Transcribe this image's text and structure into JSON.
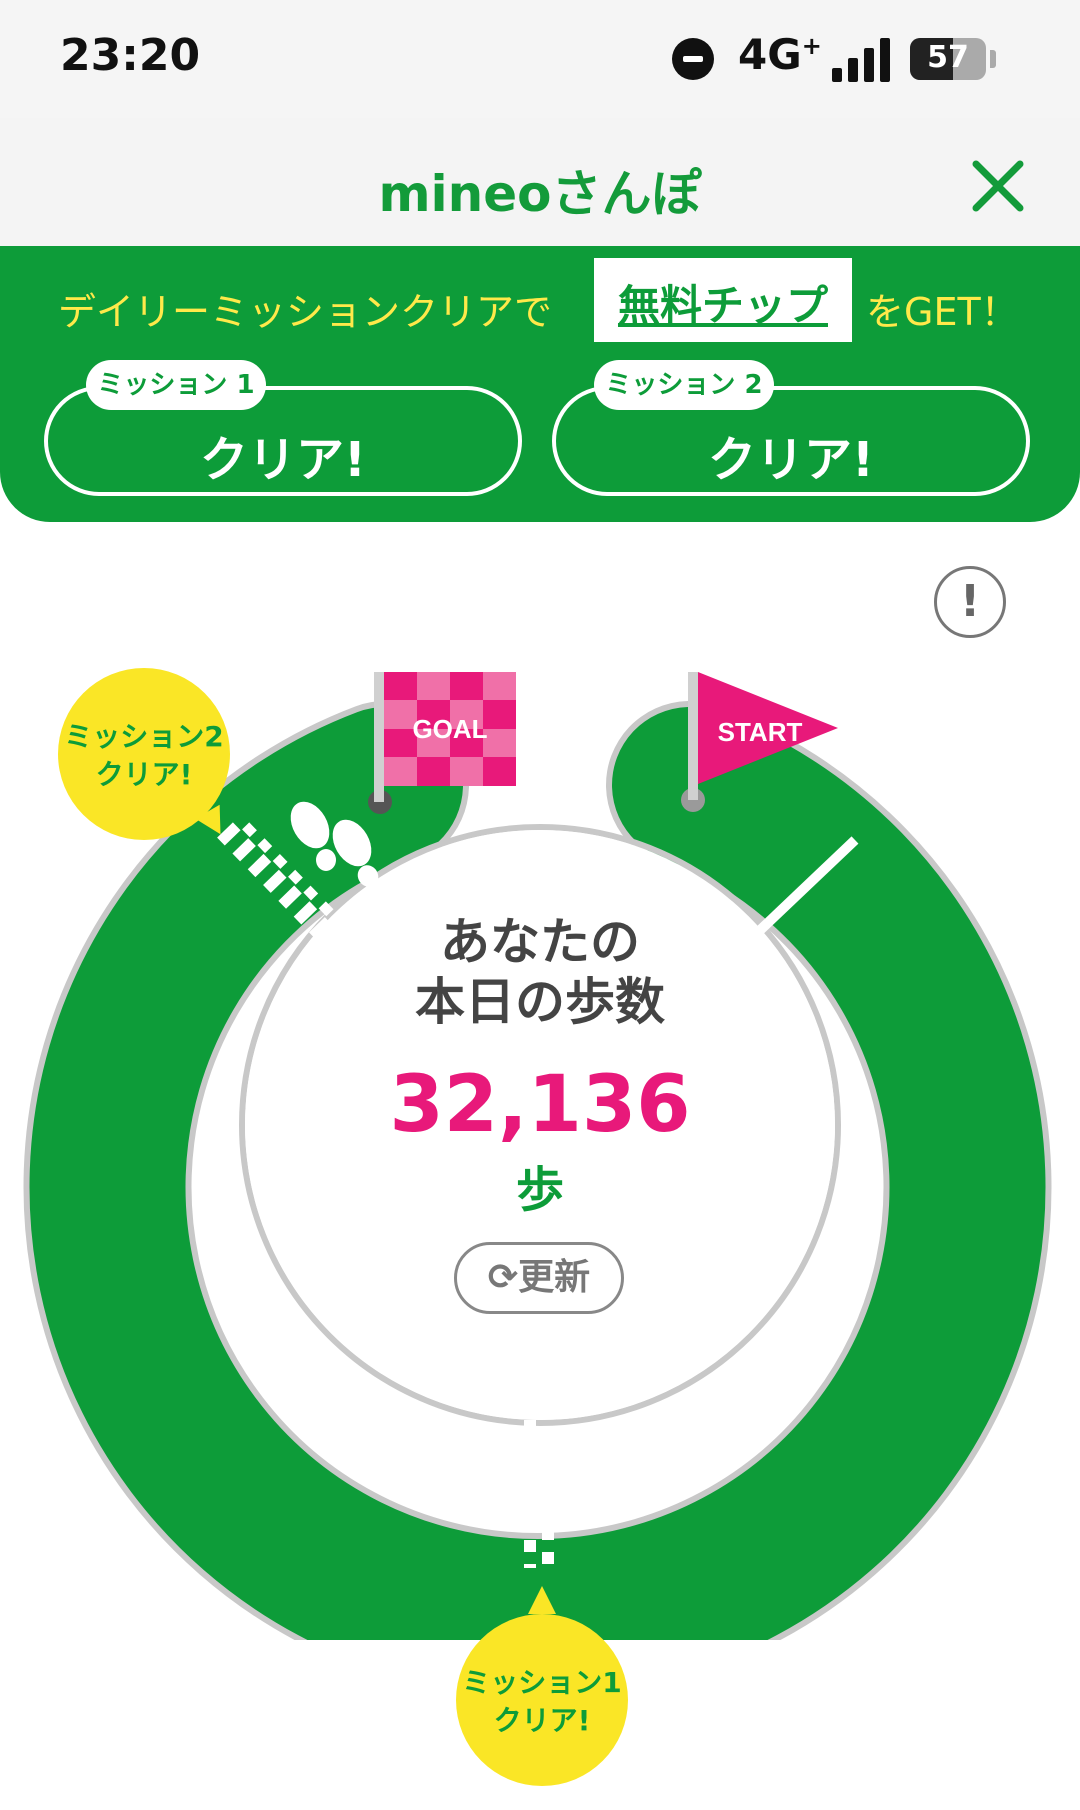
{
  "status": {
    "time": "23:20",
    "network": "4G",
    "network_sup": "+",
    "battery": "57",
    "battery_level": 0.57
  },
  "header": {
    "title": "mineoさんぽ",
    "close_icon": "close-x-icon"
  },
  "missions": {
    "banner_prefix": "デイリーミッションクリアで",
    "banner_link": "無料チップ",
    "banner_suffix": "をGET！",
    "items": [
      {
        "tag": "ミッション 1",
        "status": "クリア!"
      },
      {
        "tag": "ミッション 2",
        "status": "クリア!"
      }
    ]
  },
  "course": {
    "goal_label": "GOAL",
    "start_label": "START",
    "mission2_bubble_line1": "ミッション2",
    "mission2_bubble_line2": "クリア!",
    "mission1_bubble_line1": "ミッション1",
    "mission1_bubble_line2": "クリア!",
    "info_label": "!"
  },
  "steps": {
    "title_line1": "あなたの",
    "title_line2": "本日の歩数",
    "count": "32,136",
    "unit": "歩",
    "refresh_label": "⟳更新"
  },
  "colors": {
    "green": "#0d9c39",
    "pink": "#e8197a",
    "yellow": "#fae626",
    "banner_text": "#ffe94a"
  }
}
